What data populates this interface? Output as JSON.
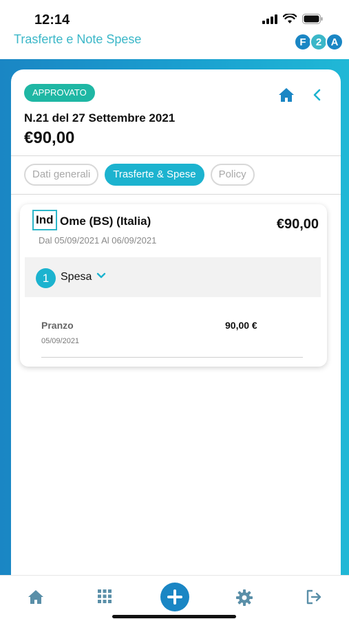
{
  "status_bar": {
    "time": "12:14"
  },
  "app_header": {
    "title": "Trasferte e Note Spese",
    "logo_letters": [
      "F",
      "2",
      "A"
    ],
    "logo_colors": [
      "#1a86c4",
      "#3bb7c8",
      "#1a86c4"
    ]
  },
  "document": {
    "status_badge": "APPROVATO",
    "title": "N.21 del 27 Settembre 2021",
    "amount": "€90,00"
  },
  "tabs": [
    {
      "label": "Dati generali",
      "active": false
    },
    {
      "label": "Trasferte & Spese",
      "active": true
    },
    {
      "label": "Policy",
      "active": false
    }
  ],
  "trip": {
    "code": "Ind",
    "place": "Ome (BS) (Italia)",
    "amount": "€90,00",
    "dates": "Dal 05/09/2021 Al 06/09/2021",
    "expense_group": {
      "count": "1",
      "label": "Spesa"
    },
    "expenses": [
      {
        "name": "Pranzo",
        "amount": "90,00 €",
        "date": "05/09/2021"
      }
    ]
  },
  "bottom_nav": [
    "home-icon",
    "grid-icon",
    "add-icon",
    "settings-icon",
    "logout-icon"
  ],
  "colors": {
    "primary": "#1cb3cf",
    "approved": "#1fb7a4",
    "accent_blue": "#1a86c4"
  }
}
